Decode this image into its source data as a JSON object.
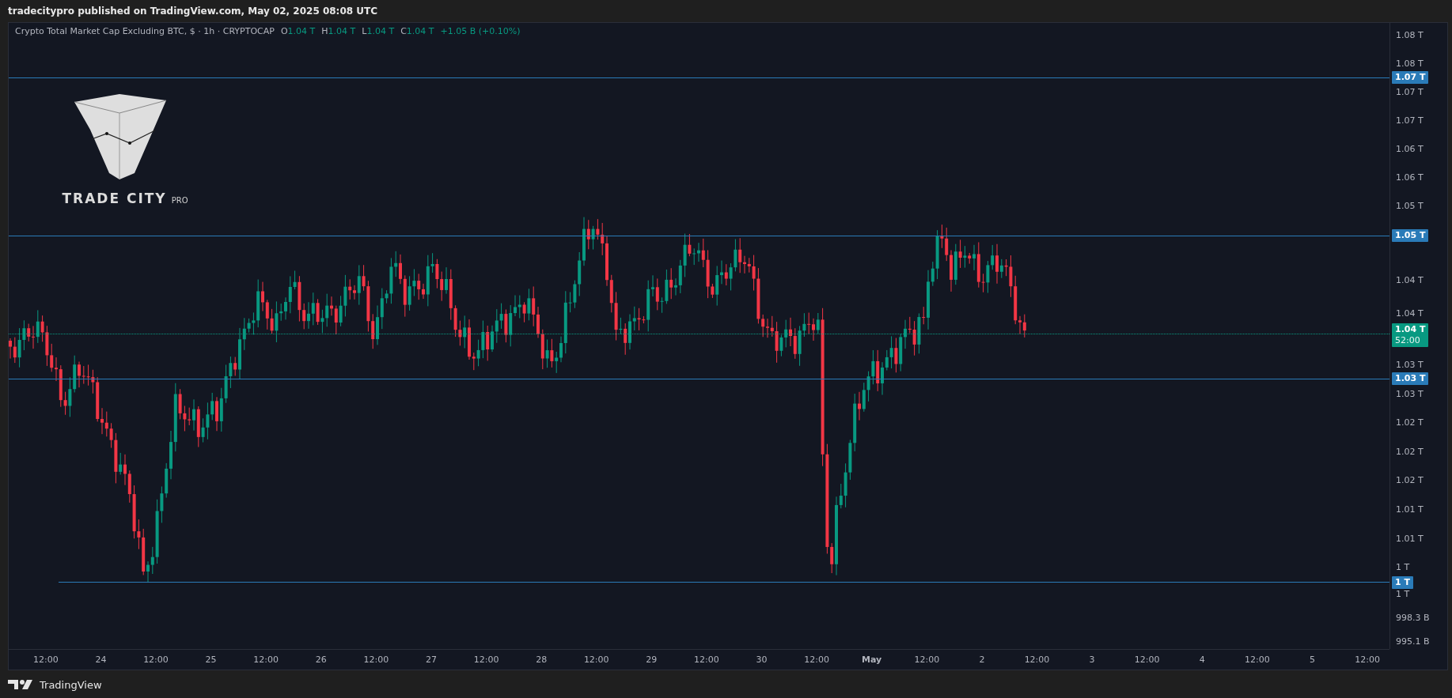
{
  "header": {
    "text": "tradecitypro published on TradingView.com, May 02, 2025 08:08 UTC"
  },
  "legend": {
    "title": "Crypto Total Market Cap Excluding BTC, $ · 1h · CRYPTOCAP",
    "ohlc": [
      {
        "label": "O",
        "value": "1.04 T"
      },
      {
        "label": "H",
        "value": "1.04 T"
      },
      {
        "label": "L",
        "value": "1.04 T"
      },
      {
        "label": "C",
        "value": "1.04 T"
      }
    ],
    "change": "+1.05 B (+0.10%)"
  },
  "overlay_logo": {
    "name": "TRADE CITY",
    "suffix": "PRO"
  },
  "levels": [
    {
      "label": "1.07 T"
    },
    {
      "label": "1.05 T"
    },
    {
      "label": "1.03 T"
    },
    {
      "label": "1 T"
    }
  ],
  "current_price": {
    "price": "1.04 T",
    "countdown": "52:00"
  },
  "price_scale": {
    "groups": [
      [
        "1.08 T",
        "1.08 T",
        "1.07 T",
        "1.07 T",
        "1.06 T",
        "1.06 T",
        "1.05 T"
      ],
      [
        "1.04 T",
        "1.04 T"
      ],
      [
        "1.03 T",
        "1.03 T",
        "1.02 T",
        "1.02 T",
        "1.02 T",
        "1.01 T",
        "1.01 T",
        "1 T"
      ],
      [
        "1 T",
        "998.3 B",
        "995.1 B"
      ]
    ]
  },
  "time_scale": [
    {
      "label": "12:00",
      "kind": "time"
    },
    {
      "label": "24",
      "kind": "day"
    },
    {
      "label": "12:00",
      "kind": "time"
    },
    {
      "label": "25",
      "kind": "day"
    },
    {
      "label": "12:00",
      "kind": "time"
    },
    {
      "label": "26",
      "kind": "day"
    },
    {
      "label": "12:00",
      "kind": "time"
    },
    {
      "label": "27",
      "kind": "day"
    },
    {
      "label": "12:00",
      "kind": "time"
    },
    {
      "label": "28",
      "kind": "day"
    },
    {
      "label": "12:00",
      "kind": "time"
    },
    {
      "label": "29",
      "kind": "day"
    },
    {
      "label": "12:00",
      "kind": "time"
    },
    {
      "label": "30",
      "kind": "day"
    },
    {
      "label": "12:00",
      "kind": "time"
    },
    {
      "label": "May",
      "kind": "month"
    },
    {
      "label": "12:00",
      "kind": "time"
    },
    {
      "label": "2",
      "kind": "day"
    },
    {
      "label": "12:00",
      "kind": "time"
    },
    {
      "label": "3",
      "kind": "day"
    },
    {
      "label": "12:00",
      "kind": "time"
    },
    {
      "label": "4",
      "kind": "day"
    },
    {
      "label": "12:00",
      "kind": "time"
    },
    {
      "label": "5",
      "kind": "day"
    },
    {
      "label": "12:00",
      "kind": "time"
    }
  ],
  "footer": {
    "brand": "TradingView"
  }
}
